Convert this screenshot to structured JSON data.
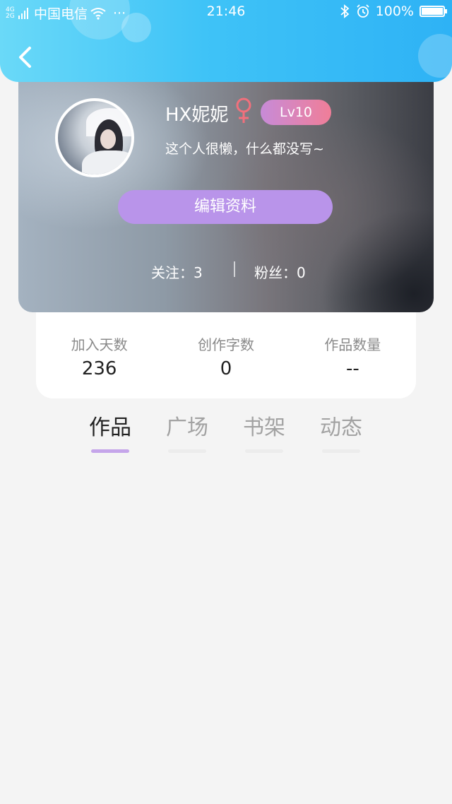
{
  "status_bar": {
    "network": "4G 2G",
    "carrier": "中国电信",
    "more": "···",
    "time": "21:46",
    "battery": "100%"
  },
  "profile": {
    "username": "HX妮妮",
    "gender": "female-symbol",
    "level": "Lv10",
    "bio": "这个人很懒，什么都没写~",
    "edit_button": "编辑资料",
    "following": "关注：3",
    "fans": "粉丝：0"
  },
  "stats": [
    {
      "label": "加入天数",
      "value": "236"
    },
    {
      "label": "创作字数",
      "value": "0"
    },
    {
      "label": "作品数量",
      "value": "--"
    }
  ],
  "tabs": [
    {
      "label": "作品",
      "active": true
    },
    {
      "label": "广场",
      "active": false
    },
    {
      "label": "书架",
      "active": false
    },
    {
      "label": "动态",
      "active": false
    }
  ],
  "colors": {
    "header_accent": "#3fc3f7",
    "edit_button": "#b994ea",
    "level_badge": "#f07e98",
    "gender": "#f2707c",
    "tab_underline": "#c5a5ea"
  },
  "icons": [
    "back-arrow-icon",
    "wifi-icon",
    "bluetooth-icon",
    "alarm-icon",
    "battery-icon",
    "female-gender-icon"
  ]
}
